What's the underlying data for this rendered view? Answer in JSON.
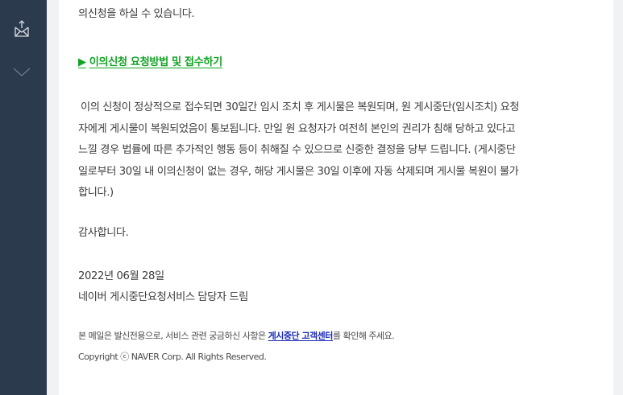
{
  "sidebar": {
    "icons": [
      "envelope-export-icon",
      "chevron-down-icon"
    ]
  },
  "content": {
    "intro_tail": "의신청을 하실 수 있습니다.",
    "link_arrow": "▶",
    "link_label": "이의신청 요청방법 및 접수하기",
    "paragraph_lines": [
      "이의 신청이 정상적으로 접수되면 30일간 임시 조치 후 게시물은 복원되며, 원 게시중단(임시조치) 요청",
      "자에게 게시물이 복원되었음이 통보됩니다. 만일 원 요청자가 여전히 본인의 권리가 침해 당하고 있다고",
      "느낄 경우 법률에 따른 추가적인 행동 등이 취해질 수 있으므로 신중한 결정을 당부 드립니다. (게시중단",
      "일로부터 30일 내 이의신청이 없는 경우, 해당 게시물은 30일 이후에 자동 삭제되며 게시물 복원이 불가",
      "합니다.)"
    ],
    "thanks": "감사합니다.",
    "date": "2022년 06월 28일",
    "signature": "네이버 게시중단요청서비스 담당자 드림"
  },
  "footer": {
    "notice_prefix": "본 메일은 발신전용으로, 서비스 관련 궁금하신 사항은 ",
    "notice_link": "게시중단 고객센터",
    "notice_suffix": "를 확인해 주세요.",
    "copyright": "Copyright ⓒ NAVER Corp. All Rights Reserved."
  },
  "colors": {
    "sidebar_bg": "#2c3a4d",
    "link_green": "#12a323",
    "link_blue": "#1a2bb8"
  }
}
